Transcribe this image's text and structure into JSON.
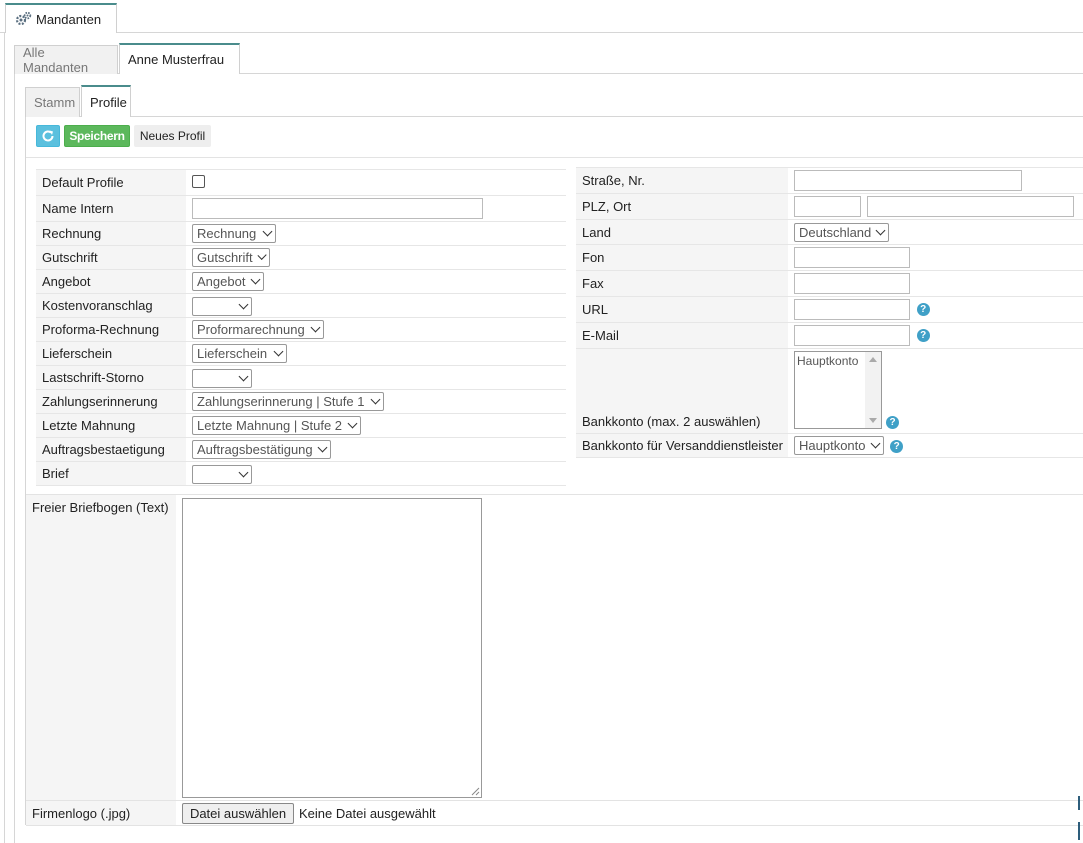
{
  "top_tab": {
    "label": "Mandanten"
  },
  "client_tabs": [
    "Alle Mandanten",
    "Anne Musterfrau"
  ],
  "sub_tabs": [
    "Stamm",
    "Profile"
  ],
  "toolbar": {
    "save_label": "Speichern",
    "new_profile_label": "Neues Profil"
  },
  "left_form": {
    "default_profile": {
      "label": "Default Profile",
      "checked": false
    },
    "name_intern": {
      "label": "Name Intern",
      "value": ""
    },
    "selects": [
      {
        "label": "Rechnung",
        "value": "Rechnung"
      },
      {
        "label": "Gutschrift",
        "value": "Gutschrift"
      },
      {
        "label": "Angebot",
        "value": "Angebot"
      },
      {
        "label": "Kostenvoranschlag",
        "value": ""
      },
      {
        "label": "Proforma-Rechnung",
        "value": "Proformarechnung"
      },
      {
        "label": "Lieferschein",
        "value": "Lieferschein"
      },
      {
        "label": "Lastschrift-Storno",
        "value": ""
      },
      {
        "label": "Zahlungserinnerung",
        "value": "Zahlungserinnerung | Stufe 1"
      },
      {
        "label": "Letzte Mahnung",
        "value": "Letzte Mahnung | Stufe 2"
      },
      {
        "label": "Auftragsbestaetigung",
        "value": "Auftragsbestätigung"
      },
      {
        "label": "Brief",
        "value": ""
      }
    ]
  },
  "right_form": {
    "street": {
      "label": "Straße, Nr.",
      "value": ""
    },
    "plz_ort": {
      "label": "PLZ, Ort",
      "plz": "",
      "ort": ""
    },
    "land": {
      "label": "Land",
      "value": "Deutschland"
    },
    "fon": {
      "label": "Fon",
      "value": ""
    },
    "fax": {
      "label": "Fax",
      "value": ""
    },
    "url": {
      "label": "URL",
      "value": ""
    },
    "email": {
      "label": "E-Mail",
      "value": ""
    },
    "bankkonto": {
      "label": "Bankkonto (max. 2 auswählen)",
      "options": [
        "Hauptkonto"
      ]
    },
    "bankkonto_versand": {
      "label": "Bankkonto für Versanddienstleister",
      "value": "Hauptkonto"
    },
    "help_glyph": "?"
  },
  "bottom": {
    "briefbogen_label": "Freier Briefbogen (Text)",
    "firmenlogo_label": "Firmenlogo (.jpg)",
    "file_button": "Datei auswählen",
    "file_status": "Keine Datei ausgewählt"
  },
  "colors": {
    "accent": "#4a8c8c",
    "save": "#5cb85c",
    "refresh": "#5bc0de",
    "help": "#3fa0c7"
  },
  "icons": {
    "top_tab": "gears-icon",
    "refresh": "refresh-icon"
  }
}
